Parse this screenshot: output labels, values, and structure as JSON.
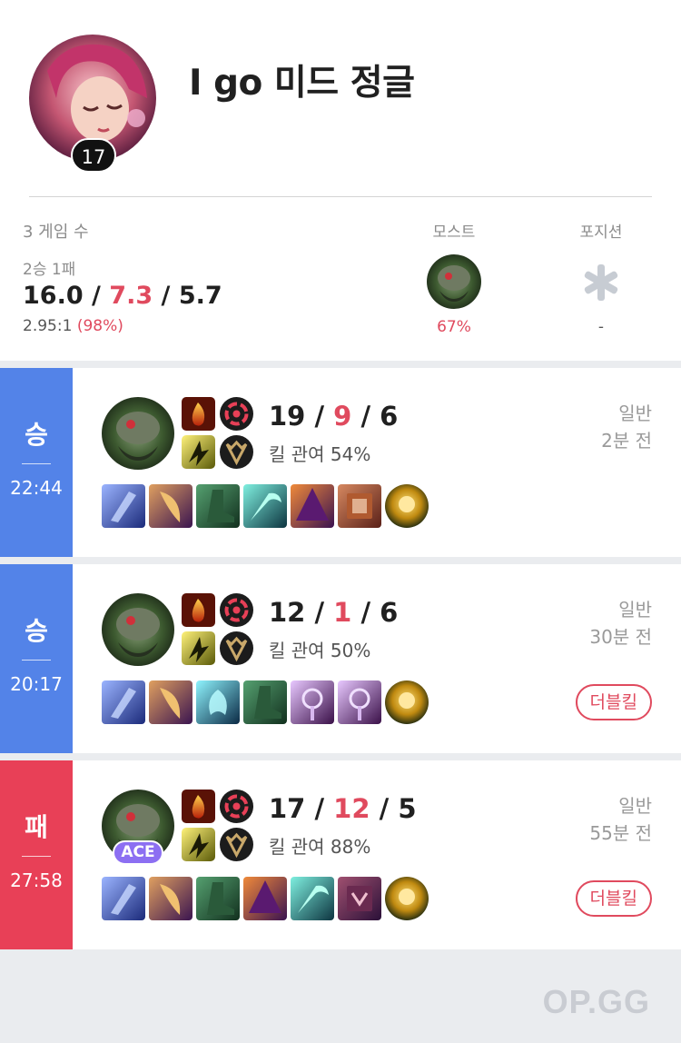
{
  "profile": {
    "name": "I go 미드 정글",
    "level": "17",
    "avatar_icon": "champion-portrait-icon"
  },
  "summary": {
    "games_label": "3 게임 수",
    "win_loss": "2승 1패",
    "kda_kills": "16.0",
    "kda_deaths": "7.3",
    "kda_assists": "5.7",
    "ratio": "2.95:1",
    "ratio_pct": "(98%)",
    "most_label": "모스트",
    "most_rate": "67%",
    "position_label": "포지션",
    "position_value": "-",
    "position_icon": "asterisk-fill-icon"
  },
  "matches": [
    {
      "result": "승",
      "duration": "22:44",
      "kills": "19",
      "deaths": "9",
      "assists": "6",
      "kill_participation": "킬 관여 54%",
      "mode": "일반",
      "time_ago": "2분 전",
      "ace": "",
      "multikill": "",
      "colors": {
        "bar": "#5383e8"
      }
    },
    {
      "result": "승",
      "duration": "20:17",
      "kills": "12",
      "deaths": "1",
      "assists": "6",
      "kill_participation": "킬 관여 50%",
      "mode": "일반",
      "time_ago": "30분 전",
      "ace": "",
      "multikill": "더블킬",
      "colors": {
        "bar": "#5383e8"
      }
    },
    {
      "result": "패",
      "duration": "27:58",
      "kills": "17",
      "deaths": "12",
      "assists": "5",
      "kill_participation": "킬 관여 88%",
      "mode": "일반",
      "time_ago": "55분 전",
      "ace": "ACE",
      "multikill": "더블킬",
      "colors": {
        "bar": "#e84057"
      }
    }
  ],
  "footer": {
    "logo": "OP.GG"
  },
  "colors": {
    "win": "#5383e8",
    "loss": "#e84057",
    "accent_red": "#e04a5e",
    "ace_purple": "#8c6ff2"
  }
}
